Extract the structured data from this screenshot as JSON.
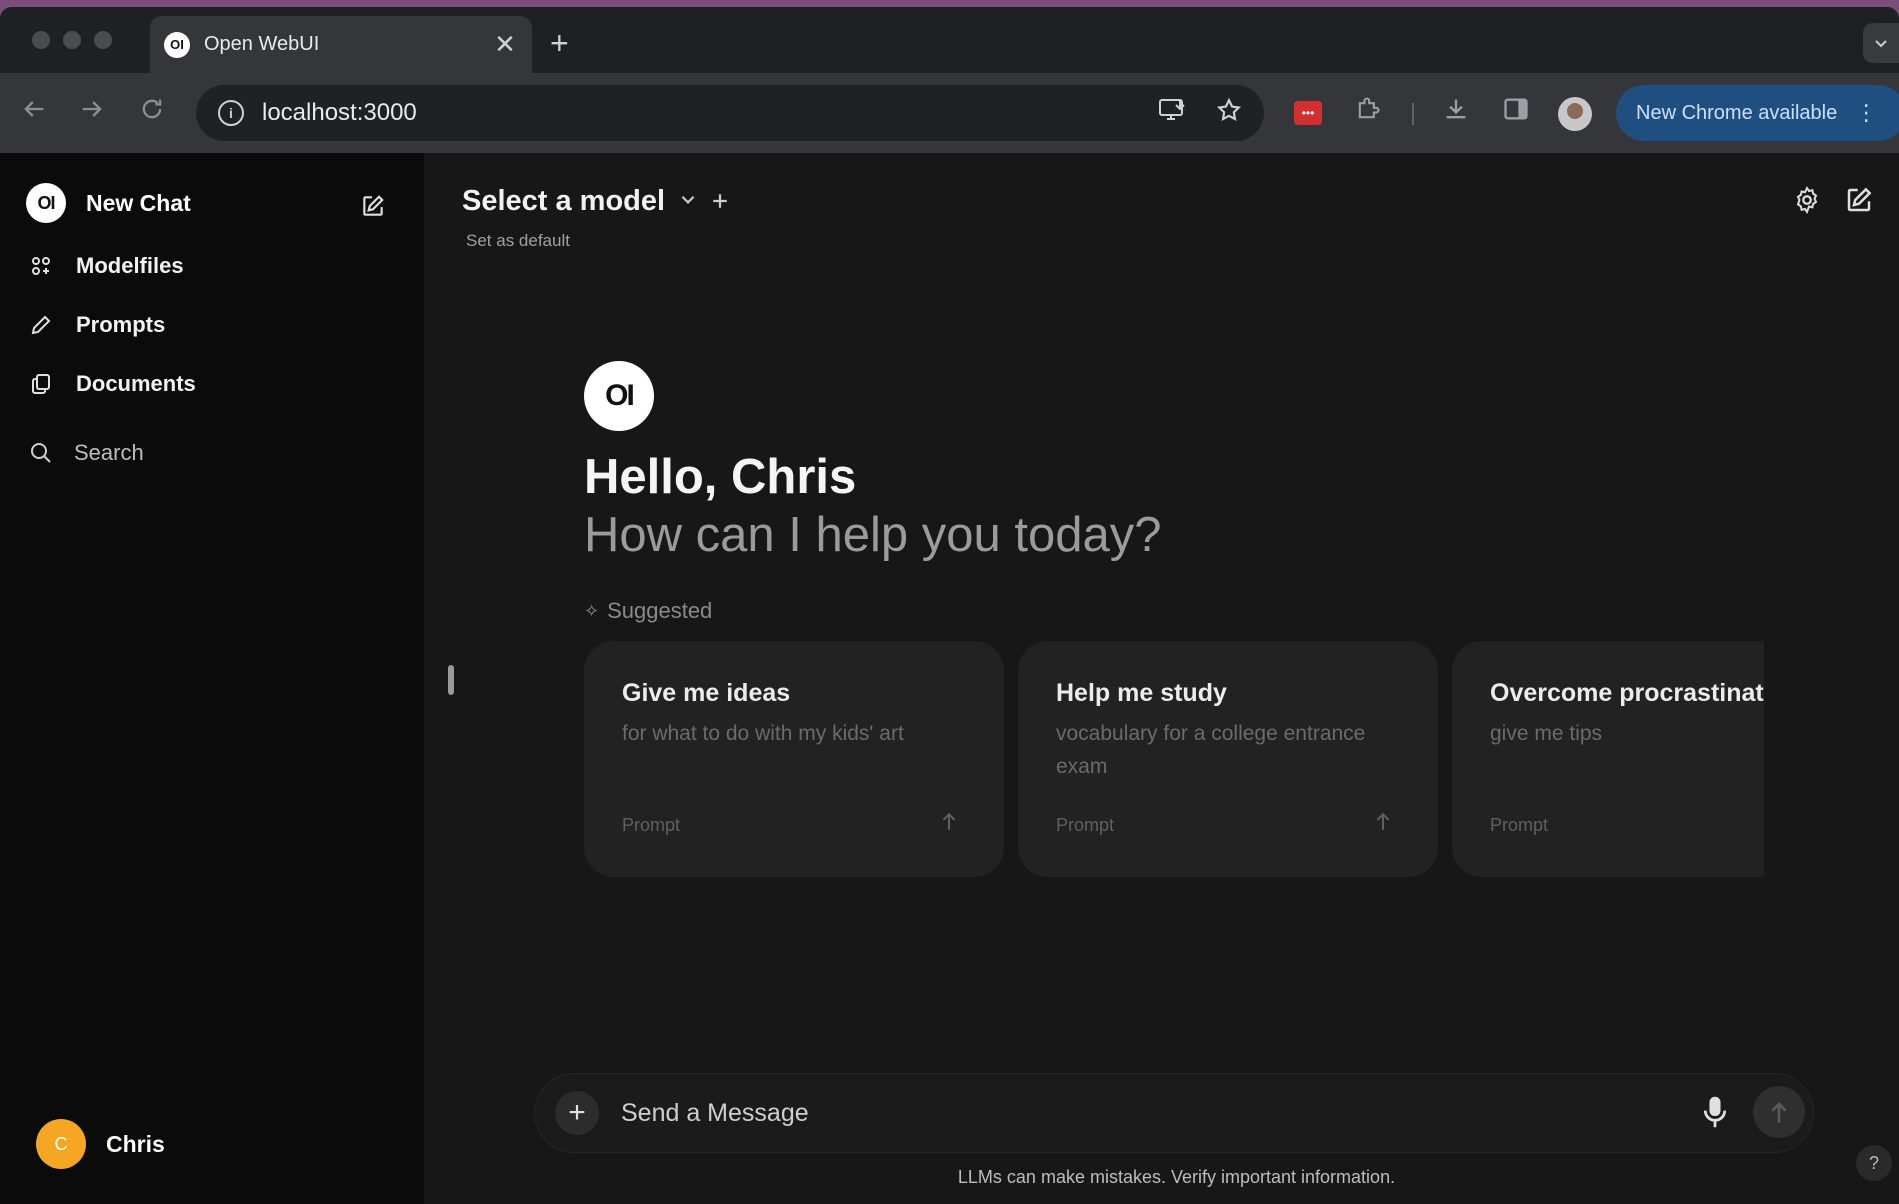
{
  "browser": {
    "tab_title": "Open WebUI",
    "tab_favicon_text": "OI",
    "close_glyph": "✕",
    "new_tab_glyph": "+",
    "url": "localhost:3000",
    "update_label": "New Chrome available",
    "update_menu_glyph": "⋮",
    "ext_badge": "•••"
  },
  "sidebar": {
    "logo_text": "OI",
    "new_chat_label": "New Chat",
    "items": [
      {
        "label": "Modelfiles",
        "icon": "modelfiles-icon"
      },
      {
        "label": "Prompts",
        "icon": "pencil-icon"
      },
      {
        "label": "Documents",
        "icon": "documents-icon"
      }
    ],
    "search_label": "Search",
    "user": {
      "initial": "C",
      "name": "Chris"
    }
  },
  "header": {
    "model_title": "Select a model",
    "set_default": "Set as default"
  },
  "hero": {
    "logo_text": "OI",
    "greeting": "Hello, Chris",
    "subtitle": "How can I help you today?",
    "suggested_label": "Suggested"
  },
  "suggestions": [
    {
      "title": "Give me ideas",
      "desc": "for what to do with my kids' art",
      "foot": "Prompt"
    },
    {
      "title": "Help me study",
      "desc": "vocabulary for a college entrance exam",
      "foot": "Prompt"
    },
    {
      "title": "Overcome procrastinat",
      "desc": "give me tips",
      "foot": "Prompt"
    }
  ],
  "composer": {
    "placeholder": "Send a Message",
    "attach_glyph": "+"
  },
  "footer": {
    "disclaimer": "LLMs can make mistakes. Verify important information.",
    "help_glyph": "?"
  },
  "colors": {
    "accent_user": "#f5a623",
    "update_pill": "#1e4f80",
    "background": "#171717",
    "sidebar": "#0b0b0b"
  }
}
